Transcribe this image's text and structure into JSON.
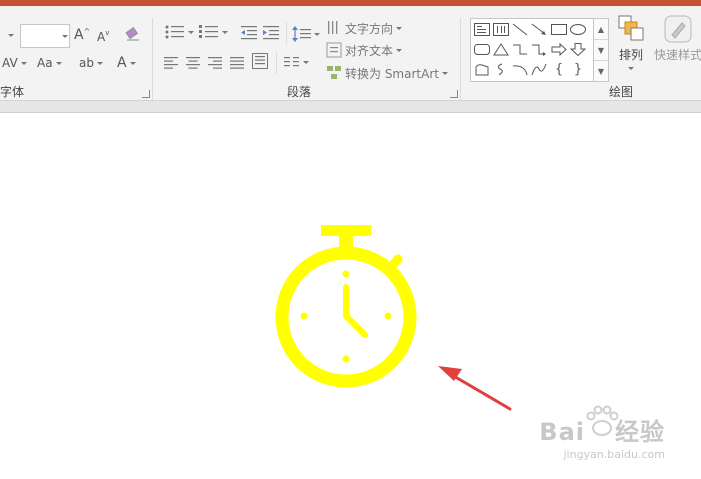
{
  "ribbon": {
    "font_group_label": "字体",
    "paragraph_group_label": "段落",
    "drawing_group_label": "绘图",
    "text_direction_label": "文字方向",
    "align_text_label": "对齐文本",
    "convert_smartart_label": "转换为 SmartArt",
    "arrange_label": "排列",
    "quick_styles_label": "快速样式",
    "font_size_value": "",
    "font_color_glyph": "A",
    "grow_font_glyph": "A",
    "shrink_font_glyph": "A",
    "char_spacing_glyph": "AV",
    "change_case_glyph": "Aa",
    "highlight_glyph": "ab",
    "brace_open": "{",
    "brace_close": "}"
  },
  "watermark": {
    "brand": "Bai",
    "brand_suffix": "经验",
    "url": "jingyan.baidu.com"
  },
  "colors": {
    "accent_bar": "#c65433",
    "stopwatch": "#ffff00",
    "arrow": "#e04040"
  }
}
